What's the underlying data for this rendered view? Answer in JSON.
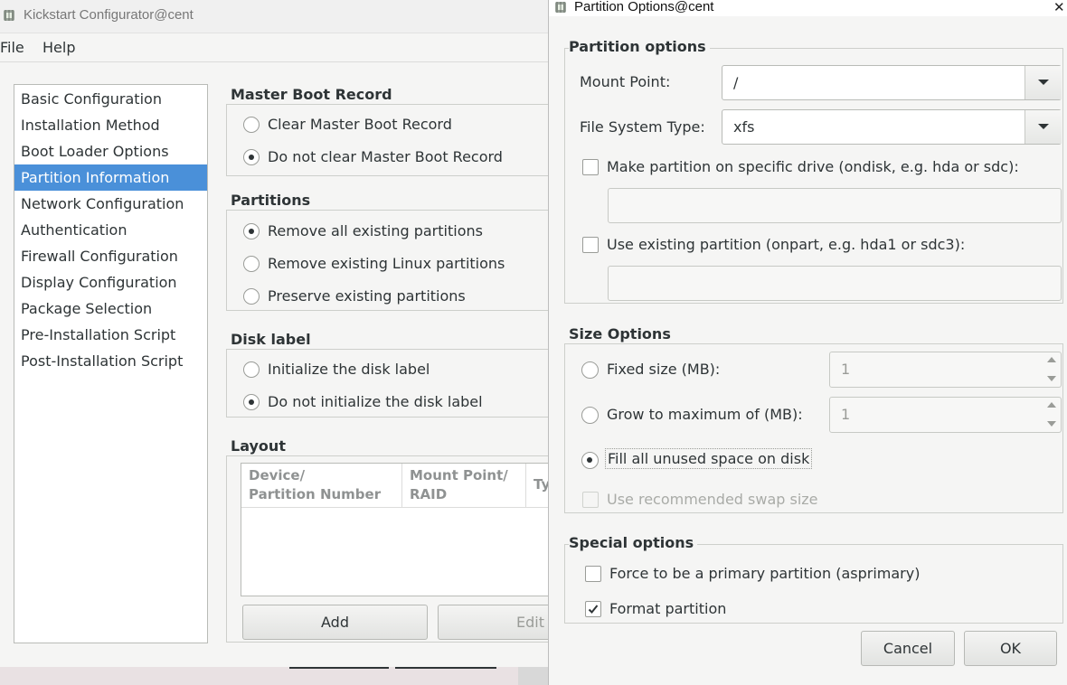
{
  "main_window": {
    "title": "Kickstart Configurator@cent",
    "menu": [
      "File",
      "Help"
    ],
    "sidebar": {
      "items": [
        {
          "label": "Basic Configuration",
          "selected": false
        },
        {
          "label": "Installation Method",
          "selected": false
        },
        {
          "label": "Boot Loader Options",
          "selected": false
        },
        {
          "label": "Partition Information",
          "selected": true
        },
        {
          "label": "Network Configuration",
          "selected": false
        },
        {
          "label": "Authentication",
          "selected": false
        },
        {
          "label": "Firewall Configuration",
          "selected": false
        },
        {
          "label": "Display Configuration",
          "selected": false
        },
        {
          "label": "Package Selection",
          "selected": false
        },
        {
          "label": "Pre-Installation Script",
          "selected": false
        },
        {
          "label": "Post-Installation Script",
          "selected": false
        }
      ]
    },
    "mbr": {
      "title": "Master Boot Record",
      "options": [
        "Clear Master Boot Record",
        "Do not clear Master Boot Record"
      ],
      "selected": 1
    },
    "partitions": {
      "title": "Partitions",
      "options": [
        "Remove all existing partitions",
        "Remove existing Linux partitions",
        "Preserve existing partitions"
      ],
      "selected": 0
    },
    "disk_label": {
      "title": "Disk label",
      "options": [
        "Initialize the disk label",
        "Do not initialize the disk label"
      ],
      "selected": 1
    },
    "layout": {
      "title": "Layout",
      "columns": [
        {
          "line1": "Device/",
          "line2": "Partition Number"
        },
        {
          "line1": "Mount Point/",
          "line2": "RAID"
        },
        {
          "line1": "Ty",
          "line2": ""
        }
      ],
      "add_label": "Add",
      "edit_label": "Edit"
    }
  },
  "dialog": {
    "title": "Partition Options@cent",
    "close_glyph": "✕",
    "partition_options": {
      "title": "Partition options",
      "mount_point_label": "Mount Point:",
      "mount_point_value": "/",
      "fs_type_label": "File System Type:",
      "fs_type_value": "xfs",
      "ondisk_label": "Make partition on specific drive (ondisk, e.g. hda or sdc):",
      "ondisk_checked": false,
      "ondisk_value": "",
      "onpart_label": "Use existing partition (onpart, e.g. hda1 or sdc3):",
      "onpart_checked": false,
      "onpart_value": ""
    },
    "size_options": {
      "title": "Size Options",
      "fixed_label": "Fixed size (MB):",
      "fixed_value": "1",
      "grow_label": "Grow to maximum of (MB):",
      "grow_value": "1",
      "fill_label": "Fill all unused space on disk",
      "selected": 2,
      "swap_label": "Use recommended swap size",
      "swap_enabled": false
    },
    "special_options": {
      "title": "Special options",
      "primary_label": "Force to be a primary partition (asprimary)",
      "primary_checked": false,
      "format_label": "Format partition",
      "format_checked": true
    },
    "cancel_label": "Cancel",
    "ok_label": "OK"
  },
  "colors": {
    "selection": "#4a90d9",
    "window_bg": "#f5f5f4",
    "desktop_bg": "#e9e1e3"
  }
}
